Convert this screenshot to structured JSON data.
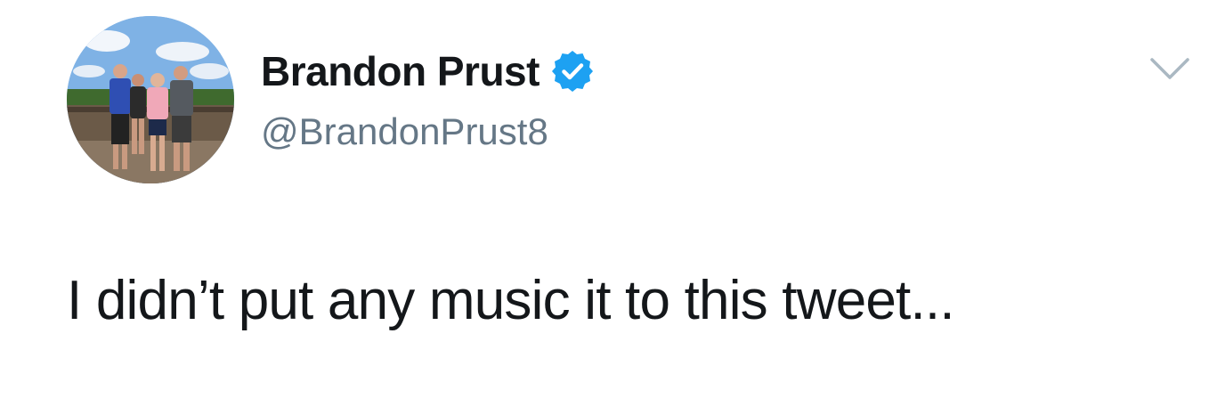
{
  "tweet": {
    "author": {
      "display_name": "Brandon Prust",
      "handle": "@BrandonPrust8",
      "verified": true,
      "avatar_icon": "profile-photo-group-outdoors"
    },
    "text": "I didn’t put any music it to this tweet...",
    "menu_icon": "chevron-down-icon"
  },
  "colors": {
    "name": "#14171a",
    "handle": "#657786",
    "verified_badge": "#1da1f2",
    "chevron": "#aab8c2",
    "background": "#ffffff"
  }
}
